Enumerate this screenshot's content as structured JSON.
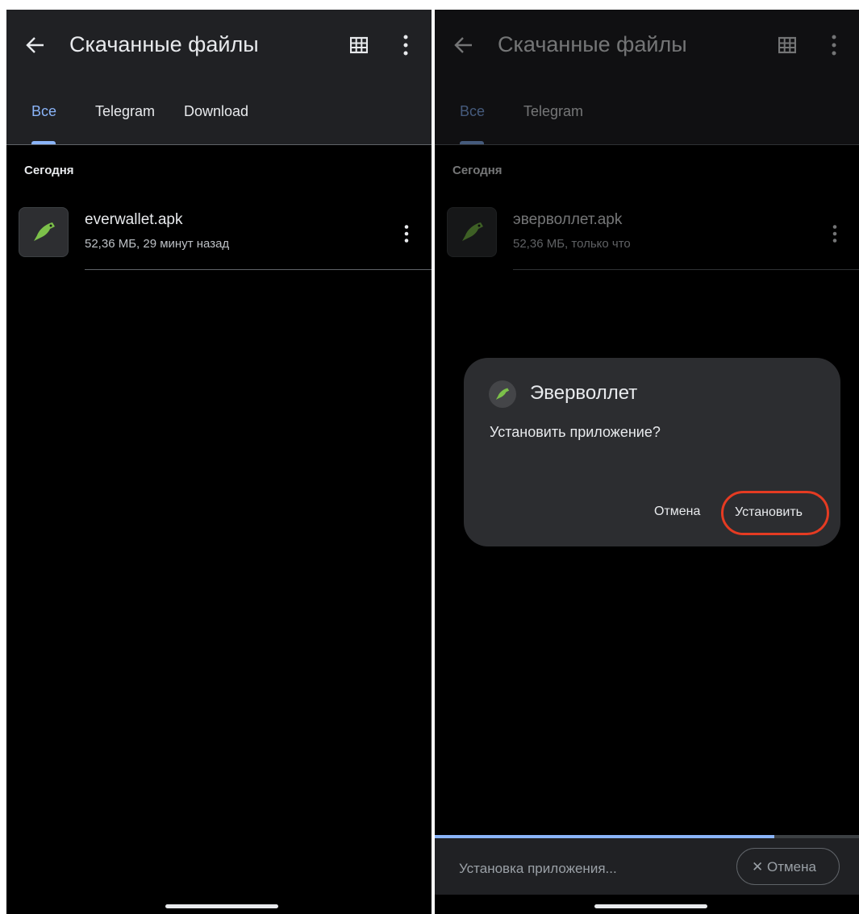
{
  "left": {
    "title": "Скачанные файлы",
    "tabs": [
      "Все",
      "Telegram",
      "Download"
    ],
    "section": "Сегодня",
    "file": {
      "name": "everwallet.apk",
      "meta": "52,36 МБ, 29 минут назад"
    }
  },
  "right": {
    "title": "Скачанные файлы",
    "tabs": [
      "Все",
      "Telegram"
    ],
    "section": "Сегодня",
    "file": {
      "name": "эверволлет.apk",
      "meta": "52,36 МБ, только что"
    },
    "dialog": {
      "app_name": "Эверволлет",
      "question": "Установить приложение?",
      "cancel_label": "Отмена",
      "install_label": "Установить"
    },
    "install_sheet": {
      "status": "Установка приложения...",
      "cancel_label": "✕ Отмена",
      "progress": 0.8
    }
  },
  "colors": {
    "accent": "#8ab4f8",
    "highlight": "#e53b22",
    "app_icon_green": "#7cc04a"
  },
  "icons": [
    "back-arrow-icon",
    "grid-view-icon",
    "more-vert-icon",
    "app-parrot-icon"
  ]
}
